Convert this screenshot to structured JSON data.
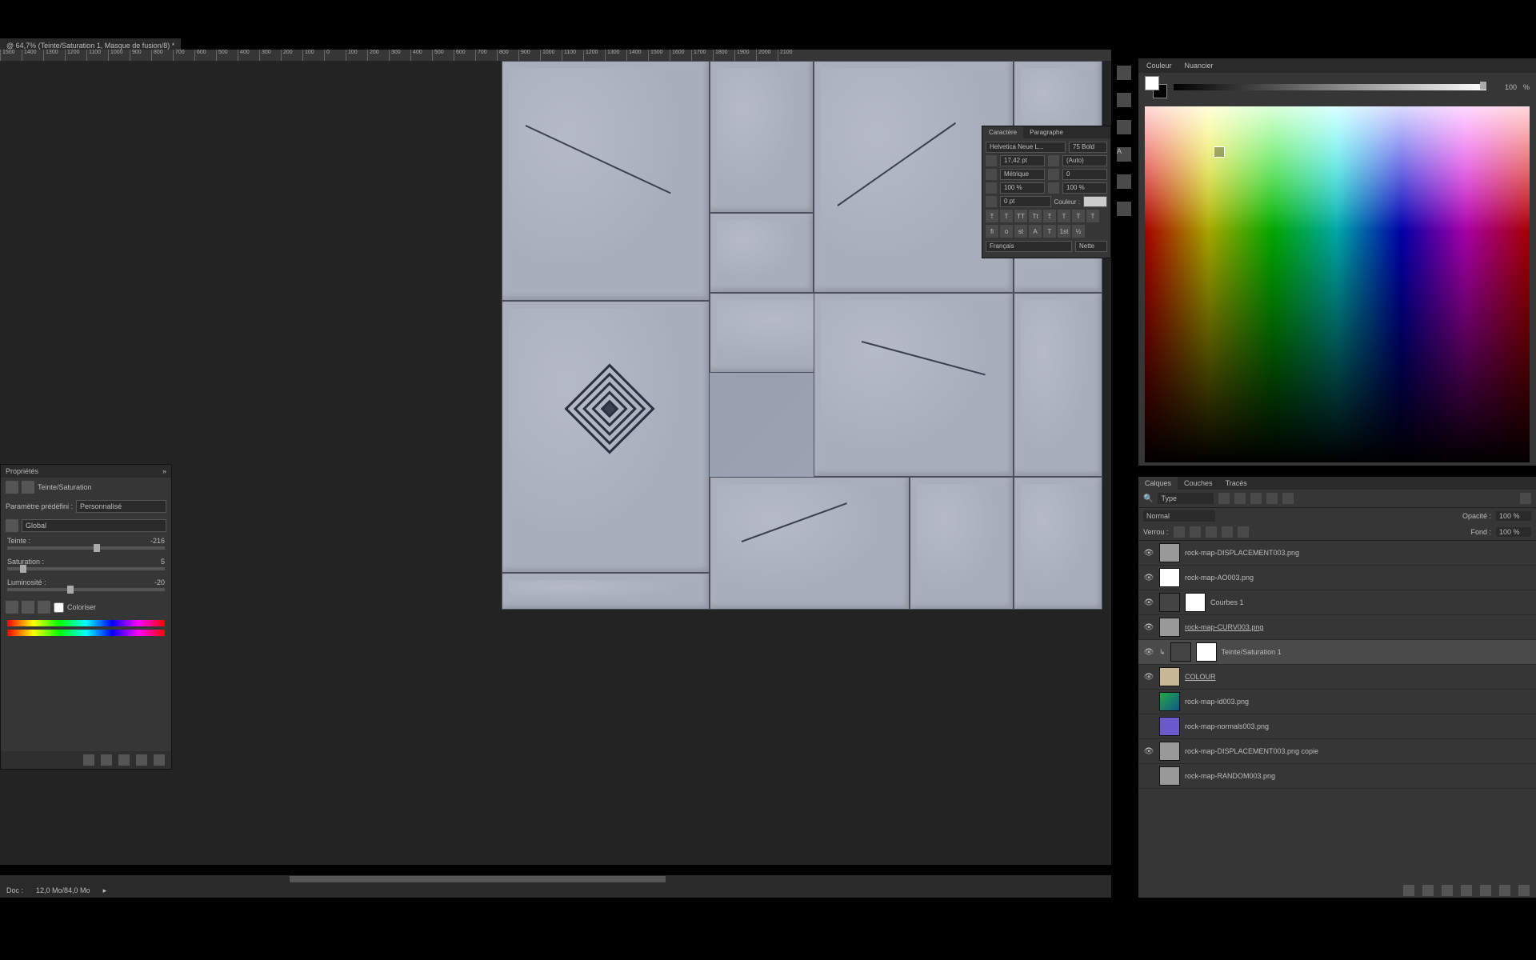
{
  "document": {
    "tab_title": "@ 64,7% (Teinte/Saturation 1, Masque de fusion/8) *"
  },
  "ruler_ticks": [
    "1500",
    "1400",
    "1300",
    "1200",
    "1100",
    "1000",
    "900",
    "800",
    "700",
    "600",
    "500",
    "400",
    "300",
    "200",
    "100",
    "0",
    "100",
    "200",
    "300",
    "400",
    "500",
    "600",
    "700",
    "800",
    "900",
    "1000",
    "1100",
    "1200",
    "1300",
    "1400",
    "1500",
    "1600",
    "1700",
    "1800",
    "1900",
    "2000",
    "2100"
  ],
  "properties": {
    "title": "Propriétés",
    "adjustment": "Teinte/Saturation",
    "preset_label": "Paramètre prédéfini :",
    "preset": "Personnalisé",
    "channel": "Global",
    "hue_label": "Teinte :",
    "hue_val": "-216",
    "sat_label": "Saturation :",
    "sat_val": "5",
    "light_label": "Luminosité :",
    "light_val": "-20",
    "colorize": "Coloriser"
  },
  "character": {
    "tab1": "Caractère",
    "tab2": "Paragraphe",
    "font": "Helvetica Neue L...",
    "weight": "75 Bold",
    "size": "17,42 pt",
    "leading_auto": "(Auto)",
    "tracking": "Métrique",
    "kerning": "0",
    "vscale": "100 %",
    "hscale": "100 %",
    "baseline": "0 pt",
    "color_label": "Couleur :",
    "lang": "Français",
    "aa": "Nette"
  },
  "color": {
    "tab1": "Couleur",
    "tab2": "Nuancier",
    "value": "100",
    "pct": "%"
  },
  "layers": {
    "tab1": "Calques",
    "tab2": "Couches",
    "tab3": "Tracés",
    "filter": "Type",
    "blend_mode": "Normal",
    "opacity_label": "Opacité :",
    "opacity": "100 %",
    "lock_label": "Verrou :",
    "fill_label": "Fond :",
    "fill": "100 %",
    "items": [
      {
        "name": "rock-map-DISPLACEMENT003.png",
        "vis": true,
        "thumb": "gray"
      },
      {
        "name": "rock-map-AO003.png",
        "vis": true,
        "thumb": "mask"
      },
      {
        "name": "Courbes 1",
        "vis": true,
        "thumb": "mask",
        "adj": true
      },
      {
        "name": "rock-map-CURV003.png",
        "vis": true,
        "thumb": "gray",
        "sel": false,
        "underline": true
      },
      {
        "name": "Teinte/Saturation 1",
        "vis": true,
        "thumb": "mask",
        "adj": true,
        "sel": true,
        "clip": true
      },
      {
        "name": "COLOUR",
        "vis": true,
        "thumb": "tan",
        "underline": true
      },
      {
        "name": "rock-map-id003.png",
        "vis": false,
        "thumb": "green"
      },
      {
        "name": "rock-map-normals003.png",
        "vis": false,
        "thumb": "purple"
      },
      {
        "name": "rock-map-DISPLACEMENT003.png copie",
        "vis": true,
        "thumb": "gray"
      },
      {
        "name": "rock-map-RANDOM003.png",
        "vis": false,
        "thumb": "gray"
      }
    ]
  },
  "status": {
    "doc": "Doc :",
    "size": "12,0 Mo/84,0 Mo"
  }
}
